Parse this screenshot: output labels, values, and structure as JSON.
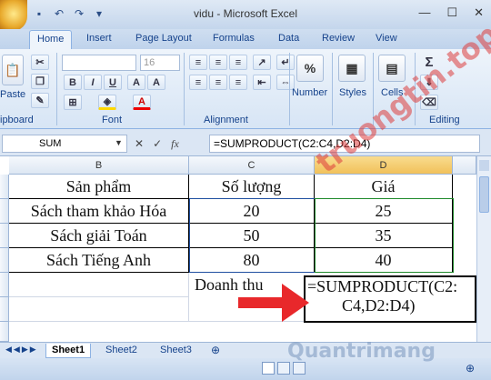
{
  "window": {
    "title": "vidu - Microsoft Excel"
  },
  "tabs": [
    "Home",
    "Insert",
    "Page Layout",
    "Formulas",
    "Data",
    "Review",
    "View"
  ],
  "ribbon": {
    "paste": "Paste",
    "clipboard": "ipboard",
    "font": "Font",
    "alignment": "Alignment",
    "number": "Number",
    "number_icon": "%",
    "styles": "Styles",
    "cells": "Cells",
    "editing": "Editing",
    "font_size": "16"
  },
  "formula_bar": {
    "name_box": "SUM",
    "fx": "fx",
    "formula": "=SUMPRODUCT(C2:C4,D2:D4)"
  },
  "columns": [
    "B",
    "C",
    "D"
  ],
  "table": {
    "headers": [
      "Sản phẩm",
      "Số lượng",
      "Giá"
    ],
    "rows": [
      [
        "Sách tham khảo Hóa",
        "20",
        "25"
      ],
      [
        "Sách giải Toán",
        "50",
        "35"
      ],
      [
        "Sách Tiếng Anh",
        "80",
        "40"
      ]
    ],
    "revenue_label": "Doanh thu",
    "revenue_formula_line1": "=SUMPRODUCT(C2:",
    "revenue_formula_line2": "C4,D2:D4)"
  },
  "sheets": [
    "Sheet1",
    "Sheet2",
    "Sheet3"
  ],
  "watermark": {
    "top": "truongtin.top",
    "bottom": "Quantrimang"
  },
  "colors": {
    "arrow": "#e8282b",
    "ribbon_bg": "#dbe7f5"
  }
}
